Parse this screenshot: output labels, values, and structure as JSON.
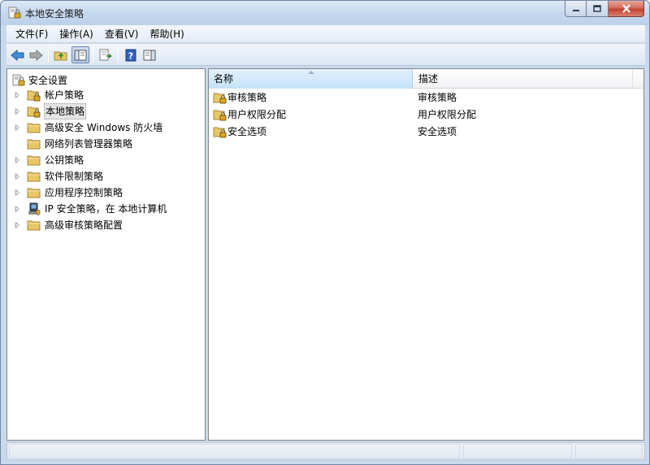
{
  "window": {
    "title": "本地安全策略"
  },
  "menu": [
    {
      "label": "文件(F)"
    },
    {
      "label": "操作(A)"
    },
    {
      "label": "查看(V)"
    },
    {
      "label": "帮助(H)"
    }
  ],
  "toolbar": {
    "buttons": [
      "back-arrow-icon",
      "forward-arrow-icon",
      "up-folder-icon",
      "show-hide-tree-icon",
      "export-list-icon",
      "help-icon",
      "show-hide-action-pane-icon"
    ]
  },
  "tree": {
    "root": {
      "label": "安全设置",
      "icon": "security-settings-icon"
    },
    "items": [
      {
        "label": "帐户策略",
        "icon": "policy-folder-icon",
        "expandable": true,
        "selected": false
      },
      {
        "label": "本地策略",
        "icon": "policy-folder-icon",
        "expandable": true,
        "selected": true
      },
      {
        "label": "高级安全 Windows 防火墙",
        "icon": "folder-icon",
        "expandable": true,
        "selected": false
      },
      {
        "label": "网络列表管理器策略",
        "icon": "folder-icon",
        "expandable": false,
        "selected": false
      },
      {
        "label": "公钥策略",
        "icon": "folder-icon",
        "expandable": true,
        "selected": false
      },
      {
        "label": "软件限制策略",
        "icon": "folder-icon",
        "expandable": true,
        "selected": false
      },
      {
        "label": "应用程序控制策略",
        "icon": "folder-icon",
        "expandable": true,
        "selected": false
      },
      {
        "label": "IP 安全策略，在 本地计算机",
        "icon": "ip-security-icon",
        "expandable": true,
        "selected": false
      },
      {
        "label": "高级审核策略配置",
        "icon": "folder-icon",
        "expandable": true,
        "selected": false
      }
    ]
  },
  "list": {
    "columns": {
      "name": "名称",
      "description": "描述"
    },
    "rows": [
      {
        "name": "审核策略",
        "description": "审核策略"
      },
      {
        "name": "用户权限分配",
        "description": "用户权限分配"
      },
      {
        "name": "安全选项",
        "description": "安全选项"
      }
    ]
  },
  "colors": {
    "folder": "#e8c767",
    "lock": "#c9a23b",
    "selection": "#e5e5e5",
    "header_active": "#c5e2f8"
  }
}
